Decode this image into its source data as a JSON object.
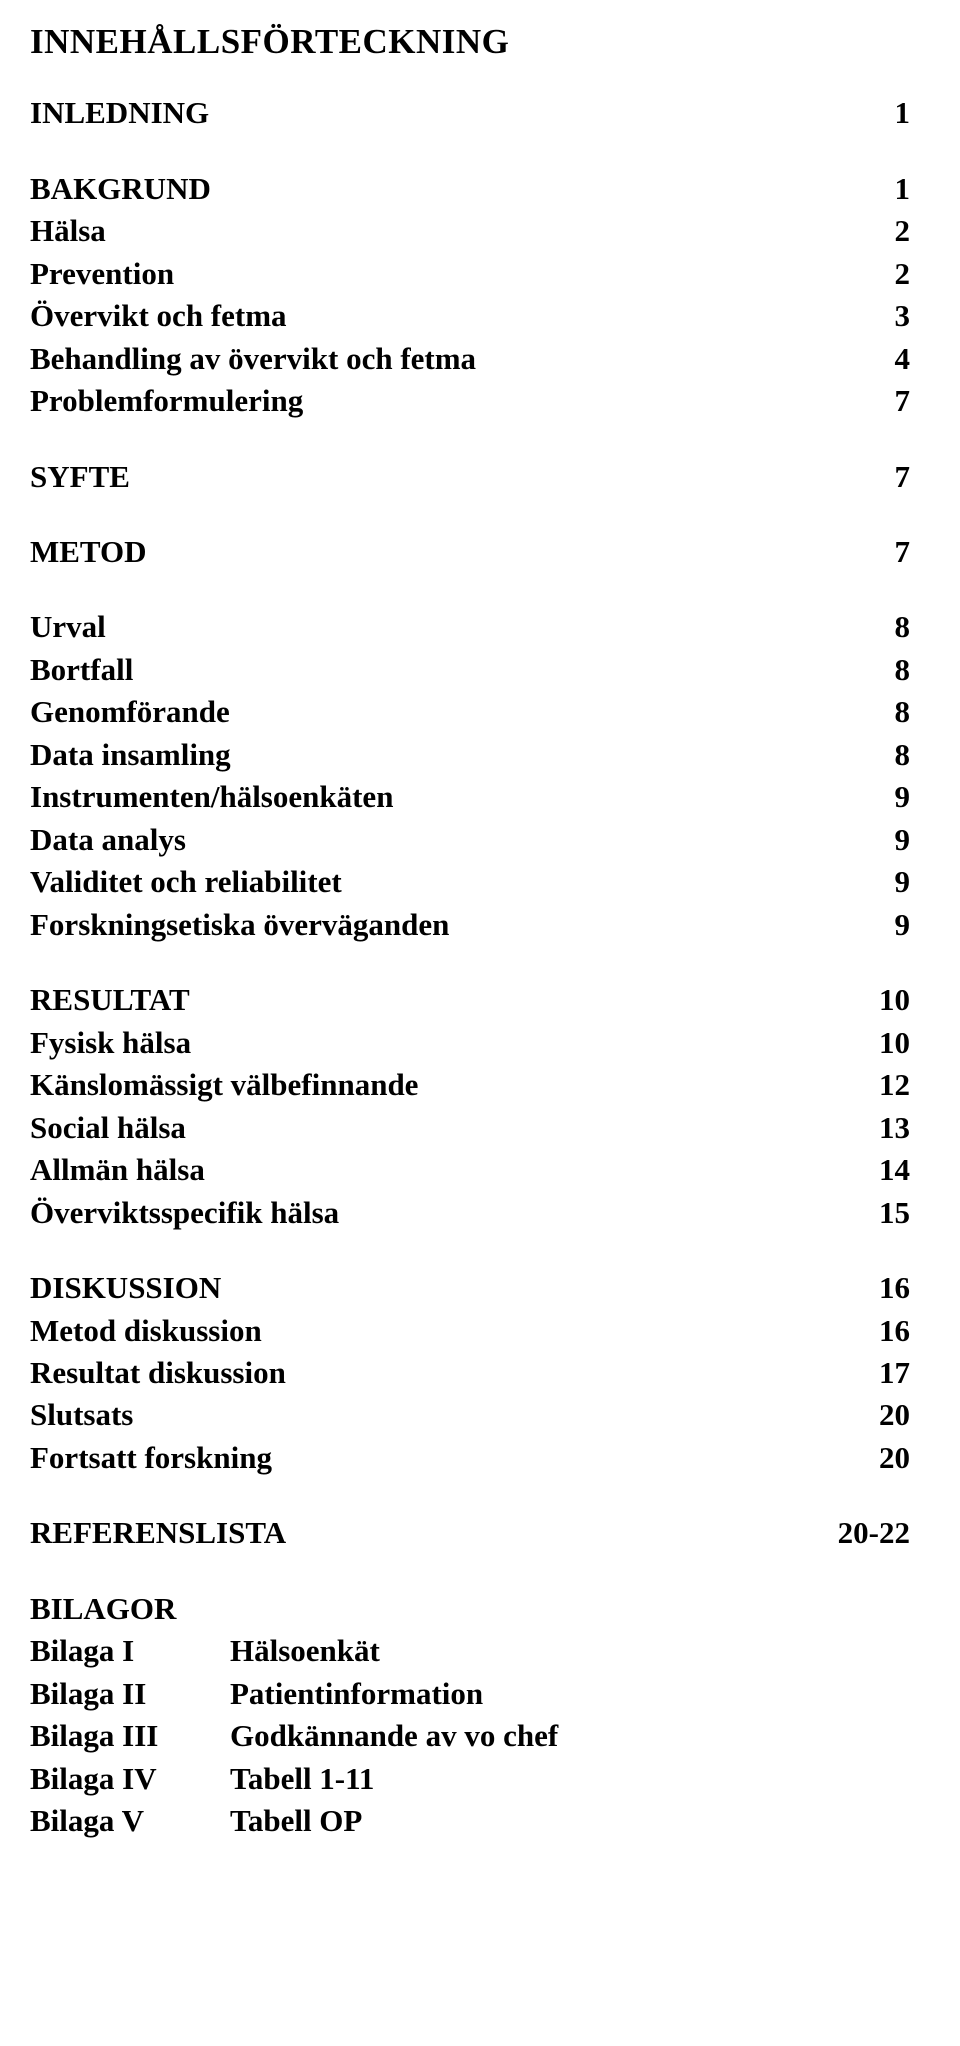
{
  "document": {
    "title": "INNEHÅLLSFÖRTECKNING"
  },
  "toc": {
    "groups": [
      {
        "entries": [
          {
            "label": "INLEDNING",
            "page": "1",
            "style": "bold"
          }
        ]
      },
      {
        "entries": [
          {
            "label": "BAKGRUND",
            "page": "1",
            "style": "bold"
          },
          {
            "label": "Hälsa",
            "page": "2",
            "style": "bold"
          },
          {
            "label": "Prevention",
            "page": "2",
            "style": "bold"
          },
          {
            "label": "Övervikt och fetma",
            "page": "3",
            "style": "bold"
          },
          {
            "label": "Behandling av övervikt och fetma",
            "page": "4",
            "style": "bold"
          },
          {
            "label": "Problemformulering",
            "page": "7",
            "style": "bold"
          }
        ]
      },
      {
        "entries": [
          {
            "label": "SYFTE",
            "page": "7",
            "style": "bold"
          }
        ]
      },
      {
        "entries": [
          {
            "label": "METOD",
            "page": "7",
            "style": "bold"
          }
        ]
      },
      {
        "entries": [
          {
            "label": "Urval",
            "page": "8",
            "style": "bold"
          },
          {
            "label": "Bortfall",
            "page": "8",
            "style": "bold"
          },
          {
            "label": "Genomförande",
            "page": "8",
            "style": "bold"
          },
          {
            "label": "Data insamling",
            "page": "8",
            "style": "bold"
          },
          {
            "label": "Instrumenten/hälsoenkäten",
            "page": "9",
            "style": "bold"
          },
          {
            "label": "Data analys",
            "page": "9",
            "style": "bold"
          },
          {
            "label": "Validitet och reliabilitet",
            "page": "9",
            "style": "bold"
          },
          {
            "label": "Forskningsetiska överväganden",
            "page": "9",
            "style": "bold"
          }
        ]
      },
      {
        "entries": [
          {
            "label": "RESULTAT",
            "page": "10",
            "style": "bold"
          },
          {
            "label": "Fysisk hälsa",
            "page": "10",
            "style": "bold"
          },
          {
            "label": "Känslomässigt välbefinnande",
            "page": "12",
            "style": "bold"
          },
          {
            "label": "Social hälsa",
            "page": "13",
            "style": "bold"
          },
          {
            "label": "Allmän hälsa",
            "page": "14",
            "style": "bold"
          },
          {
            "label": "Överviktsspecifik hälsa",
            "page": "15",
            "style": "bold"
          }
        ]
      },
      {
        "entries": [
          {
            "label": "DISKUSSION",
            "page": "16",
            "style": "bold"
          },
          {
            "label": "Metod diskussion",
            "page": "16",
            "style": "bold"
          },
          {
            "label": "Resultat diskussion",
            "page": "17",
            "style": "bold"
          },
          {
            "label": "Slutsats",
            "page": "20",
            "style": "bold"
          },
          {
            "label": "Fortsatt forskning",
            "page": "20",
            "style": "bold"
          }
        ]
      },
      {
        "entries": [
          {
            "label": "REFERENSLISTA",
            "page": "20-22",
            "style": "bold"
          }
        ]
      }
    ]
  },
  "appendices": {
    "heading": "BILAGOR",
    "items": [
      {
        "name": "Bilaga I",
        "description": "Hälsoenkät"
      },
      {
        "name": "Bilaga II",
        "description": "Patientinformation"
      },
      {
        "name": "Bilaga III",
        "description": "Godkännande av vo chef"
      },
      {
        "name": "Bilaga IV",
        "description": "Tabell 1-11"
      },
      {
        "name": "Bilaga V",
        "description": "Tabell OP"
      }
    ]
  }
}
